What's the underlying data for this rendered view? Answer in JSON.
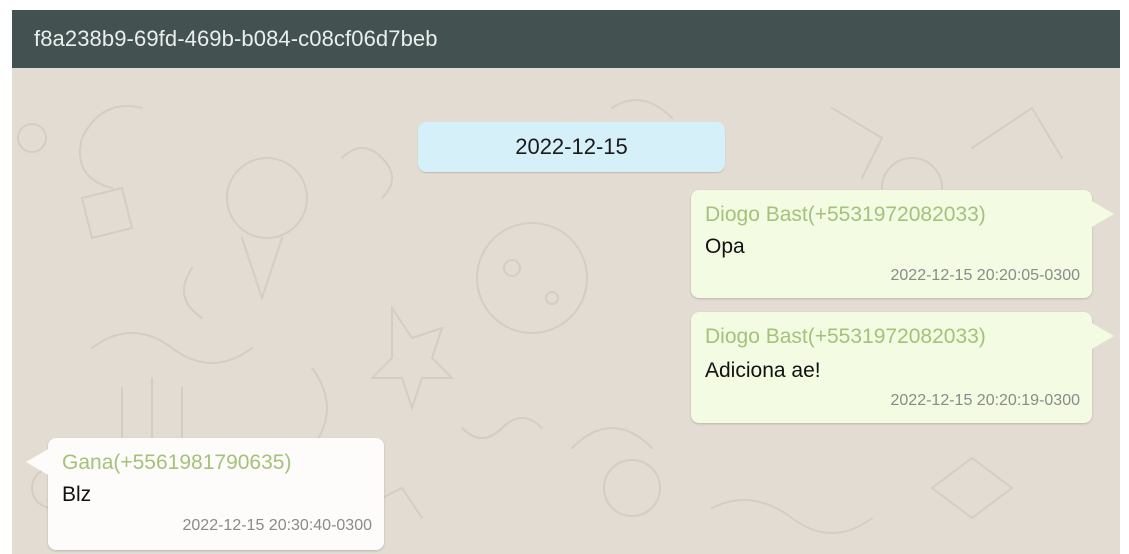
{
  "chat": {
    "title": "f8a238b9-69fd-469b-b084-c08cf06d7beb",
    "date_separator": "2022-12-15",
    "messages": [
      {
        "direction": "outgoing",
        "sender": "Diogo Bast(+5531972082033)",
        "text": "Opa",
        "timestamp": "2022-12-15 20:20:05-0300"
      },
      {
        "direction": "outgoing",
        "sender": "Diogo Bast(+5531972082033)",
        "text": "Adiciona ae!",
        "timestamp": "2022-12-15 20:20:19-0300"
      },
      {
        "direction": "incoming",
        "sender": "Gana(+5561981790635)",
        "text": "Blz",
        "timestamp": "2022-12-15 20:30:40-0300"
      }
    ]
  },
  "colors": {
    "header_bg": "#435250",
    "wallpaper_bg": "#e3dcd3",
    "outgoing_bubble": "#f3fbe2",
    "incoming_bubble": "#fdfcfa",
    "date_badge": "#d6f0fa",
    "sender_name": "#a4c27a"
  }
}
